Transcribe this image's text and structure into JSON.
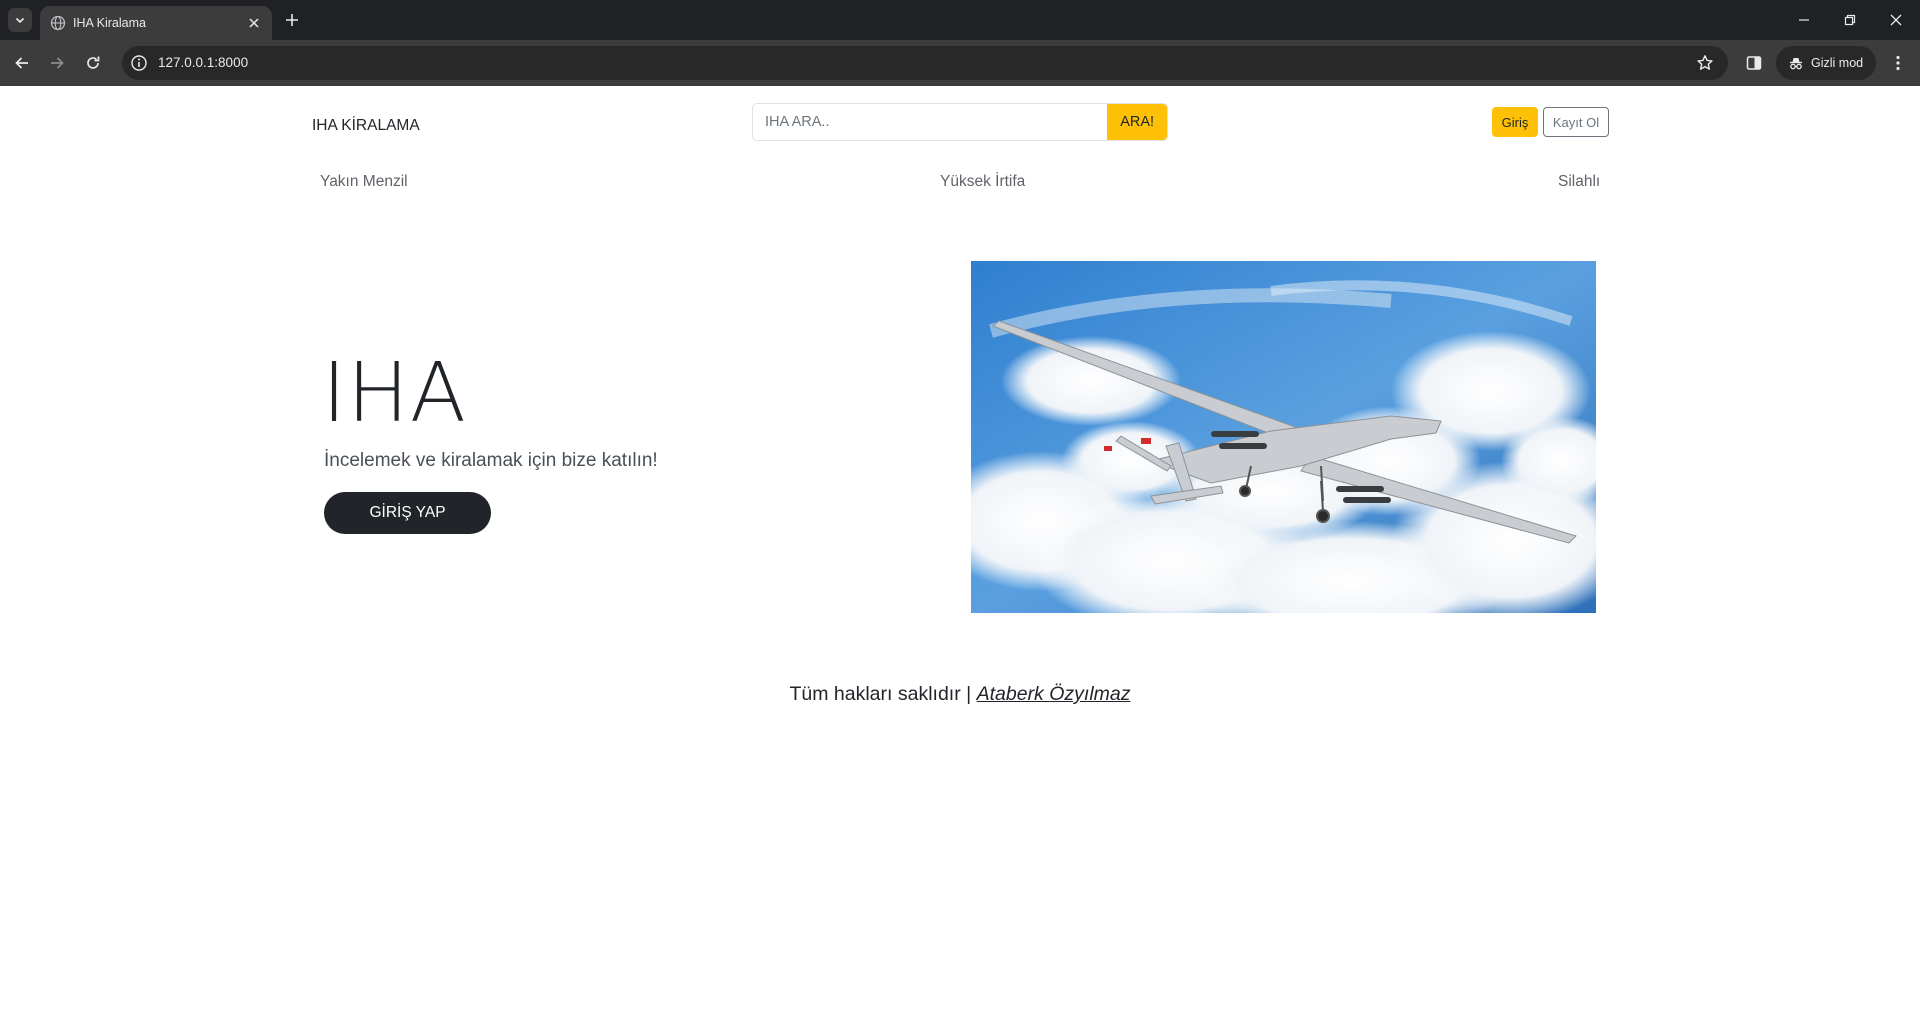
{
  "browser": {
    "tab_title": "IHA Kiralama",
    "url": "127.0.0.1:8000",
    "incognito_label": "Gizli mod"
  },
  "nav": {
    "brand": "IHA KİRALAMA",
    "search_placeholder": "IHA ARA..",
    "search_button": "ARA!",
    "login_button": "Giriş",
    "register_button": "Kayıt Ol",
    "categories": [
      "Yakın Menzil",
      "Yüksek İrtifa",
      "Silahlı"
    ]
  },
  "hero": {
    "title": "IHA",
    "subtitle": "İncelemek ve kiralamak için bize katılın!",
    "cta": "GİRİŞ YAP"
  },
  "footer": {
    "text": "Tüm hakları saklıdır |",
    "author": "Ataberk Özyılmaz"
  },
  "colors": {
    "accent": "#ffc107",
    "dark": "#212529",
    "chrome_bg": "#202124",
    "toolbar_bg": "#3c3c3c"
  },
  "icons": [
    "tab-list-icon",
    "globe-icon",
    "close-icon",
    "plus-icon",
    "minimize-icon",
    "restore-icon",
    "window-close-icon",
    "back-icon",
    "forward-icon",
    "reload-icon",
    "info-icon",
    "star-icon",
    "side-panel-icon",
    "incognito-icon",
    "menu-icon"
  ]
}
